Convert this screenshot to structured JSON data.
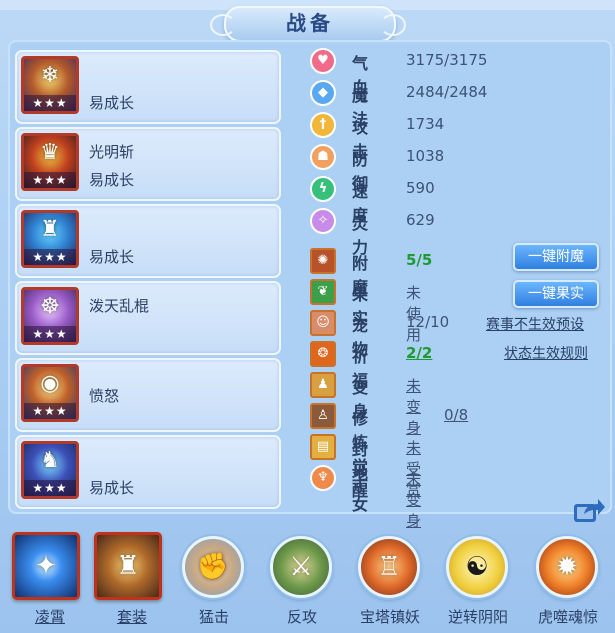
{
  "title": "战备",
  "equipment": [
    {
      "name": "",
      "effect": "易成长",
      "stars": "★★★"
    },
    {
      "name": "光明斩",
      "effect": "易成长",
      "stars": "★★★"
    },
    {
      "name": "",
      "effect": "易成长",
      "stars": "★★★"
    },
    {
      "name": "泼天乱棍",
      "effect": "",
      "stars": "★★★"
    },
    {
      "name": "",
      "effect": "愤怒",
      "stars": "★★★"
    },
    {
      "name": "",
      "effect": "易成长",
      "stars": "★★★"
    }
  ],
  "stats": [
    {
      "label": "气血",
      "value": "3175/3175",
      "icon": "heart-icon",
      "color": "#f06b8a"
    },
    {
      "label": "魔法",
      "value": "2484/2484",
      "icon": "shield-icon",
      "color": "#5aa8f0"
    },
    {
      "label": "攻击",
      "value": "1734",
      "icon": "sword-icon",
      "color": "#f2b63a"
    },
    {
      "label": "防御",
      "value": "1038",
      "icon": "defense-icon",
      "color": "#f2a060"
    },
    {
      "label": "速度",
      "value": "590",
      "icon": "speed-icon",
      "color": "#36c07a"
    },
    {
      "label": "灵力",
      "value": "629",
      "icon": "spirit-icon",
      "color": "#c78ce8"
    }
  ],
  "extras": [
    {
      "label": "附魔",
      "value": "5/5",
      "icon": "enchant-icon"
    },
    {
      "label": "果实",
      "value": "未使用",
      "icon": "fruit-icon"
    },
    {
      "label": "宠物",
      "value": "12/10",
      "icon": "pet-icon"
    },
    {
      "label": "祈福",
      "value": "2/2",
      "icon": "blessing-icon"
    },
    {
      "label": "变身",
      "value": "未变身",
      "icon": "transform-icon"
    },
    {
      "label": "修炼觉醒",
      "value": "0/8",
      "icon": "cultivation-icon"
    },
    {
      "label": "封地",
      "value": "未受赏",
      "icon": "fief-icon"
    },
    {
      "label": "子女",
      "value": "未变身",
      "icon": "children-icon"
    }
  ],
  "buttons": {
    "enchant_all": "一键附魔",
    "fruit_all": "一键果实",
    "preset_note": "赛事不生效预设",
    "status_rules": "状态生效规则"
  },
  "skills": [
    {
      "label": "凌霄",
      "icon": "lingxiao-icon"
    },
    {
      "label": "套装",
      "icon": "suit-icon"
    },
    {
      "label": "猛击",
      "icon": "fist-icon"
    },
    {
      "label": "反攻",
      "icon": "counter-icon"
    },
    {
      "label": "宝塔镇妖",
      "icon": "pagoda-icon"
    },
    {
      "label": "逆转阴阳",
      "icon": "yinyang-icon"
    },
    {
      "label": "虎噬魂惊",
      "icon": "tiger-icon"
    }
  ]
}
